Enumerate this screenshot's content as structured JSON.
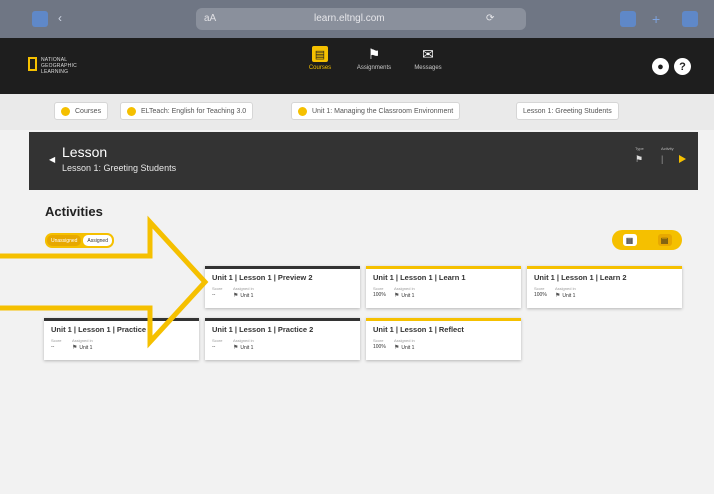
{
  "browser": {
    "aa": "aA",
    "url": "learn.eltngl.com",
    "ext": "⟳"
  },
  "header": {
    "logo_line1": "NATIONAL",
    "logo_line2": "GEOGRAPHIC",
    "logo_line3": "LEARNING",
    "nav": [
      {
        "label": "Courses",
        "icon": "course-book-icon",
        "active": true
      },
      {
        "label": "Assignments",
        "icon": "flag-icon",
        "active": false
      },
      {
        "label": "Messages",
        "icon": "envelope-icon",
        "active": false
      }
    ]
  },
  "breadcrumb": [
    "Courses",
    "ELTeach: English for Teaching 3.0",
    "Unit 1: Managing the Classroom Environment",
    "Lesson 1: Greeting Students"
  ],
  "lesson": {
    "title": "Lesson",
    "subtitle": "Lesson 1: Greeting Students",
    "meta_left": "Type",
    "meta_right": "Activity"
  },
  "activities": {
    "title": "Activities",
    "filter_selected": "Unassigned",
    "filter_other": "Assigned",
    "cards": [
      {
        "title": "Unit 1 | Lesson 1 | Preview 2",
        "score_label": "Score",
        "score": "--",
        "assigned_label": "Assigned in",
        "assigned": "Unit 1"
      },
      {
        "title": "Unit 1 | Lesson 1 | Learn 1",
        "score_label": "Score",
        "score": "100%",
        "assigned_label": "Assigned in",
        "assigned": "Unit 1"
      },
      {
        "title": "Unit 1 | Lesson 1 | Learn 2",
        "score_label": "Score",
        "score": "100%",
        "assigned_label": "Assigned in",
        "assigned": "Unit 1"
      },
      {
        "title": "Unit 1 | Lesson 1 | Practice 1",
        "score_label": "Score",
        "score": "--",
        "assigned_label": "Assigned in",
        "assigned": "Unit 1"
      },
      {
        "title": "Unit 1 | Lesson 1 | Practice 2",
        "score_label": "Score",
        "score": "--",
        "assigned_label": "Assigned in",
        "assigned": "Unit 1"
      },
      {
        "title": "Unit 1 | Lesson 1 | Reflect",
        "score_label": "Score",
        "score": "100%",
        "assigned_label": "Assigned in",
        "assigned": "Unit 1"
      }
    ]
  },
  "colors": {
    "accent": "#f5c000",
    "header_bg": "#1e1e1e",
    "band_bg": "#333333",
    "arrow_outline": "#f5c000"
  }
}
